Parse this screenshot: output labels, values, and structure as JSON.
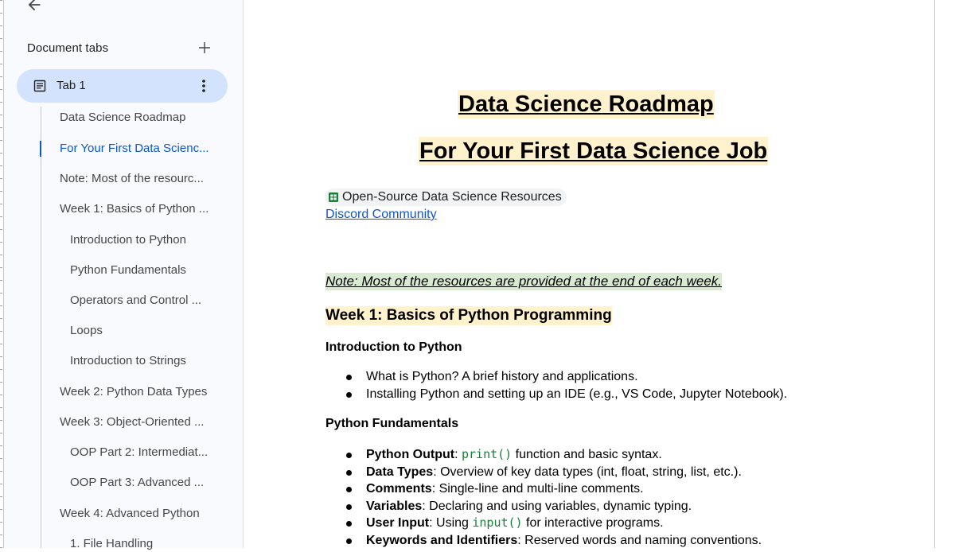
{
  "sidebar": {
    "header": "Document tabs",
    "tab": {
      "label": "Tab 1"
    },
    "outline": [
      {
        "label": "Data Science Roadmap",
        "level": 1
      },
      {
        "label": "For Your First Data Scienc...",
        "level": 1,
        "active": true
      },
      {
        "label": "Note: Most of the resourc...",
        "level": 1
      },
      {
        "label": "Week 1: Basics of Python ...",
        "level": 1
      },
      {
        "label": "Introduction to Python",
        "level": 2
      },
      {
        "label": "Python Fundamentals",
        "level": 2
      },
      {
        "label": "Operators and Control ...",
        "level": 2
      },
      {
        "label": "Loops",
        "level": 2
      },
      {
        "label": "Introduction to Strings",
        "level": 2
      },
      {
        "label": "Week 2: Python Data Types",
        "level": 1
      },
      {
        "label": "Week 3: Object-Oriented ...",
        "level": 1
      },
      {
        "label": "OOP Part 2: Intermediat...",
        "level": 2
      },
      {
        "label": "OOP Part 3: Advanced ...",
        "level": 2
      },
      {
        "label": "Week 4: Advanced Python",
        "level": 1
      },
      {
        "label": "1. File Handling",
        "level": 2
      }
    ]
  },
  "document": {
    "title1": "Data Science Roadmap",
    "title2": "For Your First Data Science Job",
    "resource_chip": "Open-Source Data Science Resources",
    "community_link": "Discord Community",
    "note": "Note: Most of the resources are provided at the end of each week.",
    "week1_heading": "Week 1: Basics of Python Programming",
    "intro_heading": "Introduction to Python",
    "intro_bullets": [
      "What is Python? A brief history and applications.",
      "Installing Python and setting up an IDE (e.g., VS Code, Jupyter Notebook)."
    ],
    "fundamentals_heading": "Python Fundamentals",
    "fundamentals_bullets": [
      {
        "term": "Python Output",
        "sep": ": ",
        "code": "print()",
        "rest": " function and basic syntax."
      },
      {
        "term": "Data Types",
        "sep": ": ",
        "code": "",
        "rest": "Overview of key data types (int, float, string, list, etc.)."
      },
      {
        "term": "Comments",
        "sep": ": ",
        "code": "",
        "rest": "Single-line and multi-line comments."
      },
      {
        "term": "Variables",
        "sep": ": ",
        "code": "",
        "rest": "Declaring and using variables, dynamic typing."
      },
      {
        "term": "User Input",
        "sep": ": Using ",
        "code": "input()",
        "rest": " for interactive programs."
      },
      {
        "term": "Keywords and Identifiers",
        "sep": ": ",
        "code": "",
        "rest": "Reserved words and naming conventions."
      }
    ]
  },
  "colors": {
    "tab_highlight": "#d3e3fd",
    "active_outline": "#0b57d0",
    "title_highlight": "#fff2cc",
    "note_highlight": "#d9ead3",
    "link": "#1155cc",
    "code": "#188038"
  },
  "icons": [
    "arrow-back-icon",
    "plus-icon",
    "document-icon",
    "more-vert-icon",
    "sheets-icon"
  ]
}
